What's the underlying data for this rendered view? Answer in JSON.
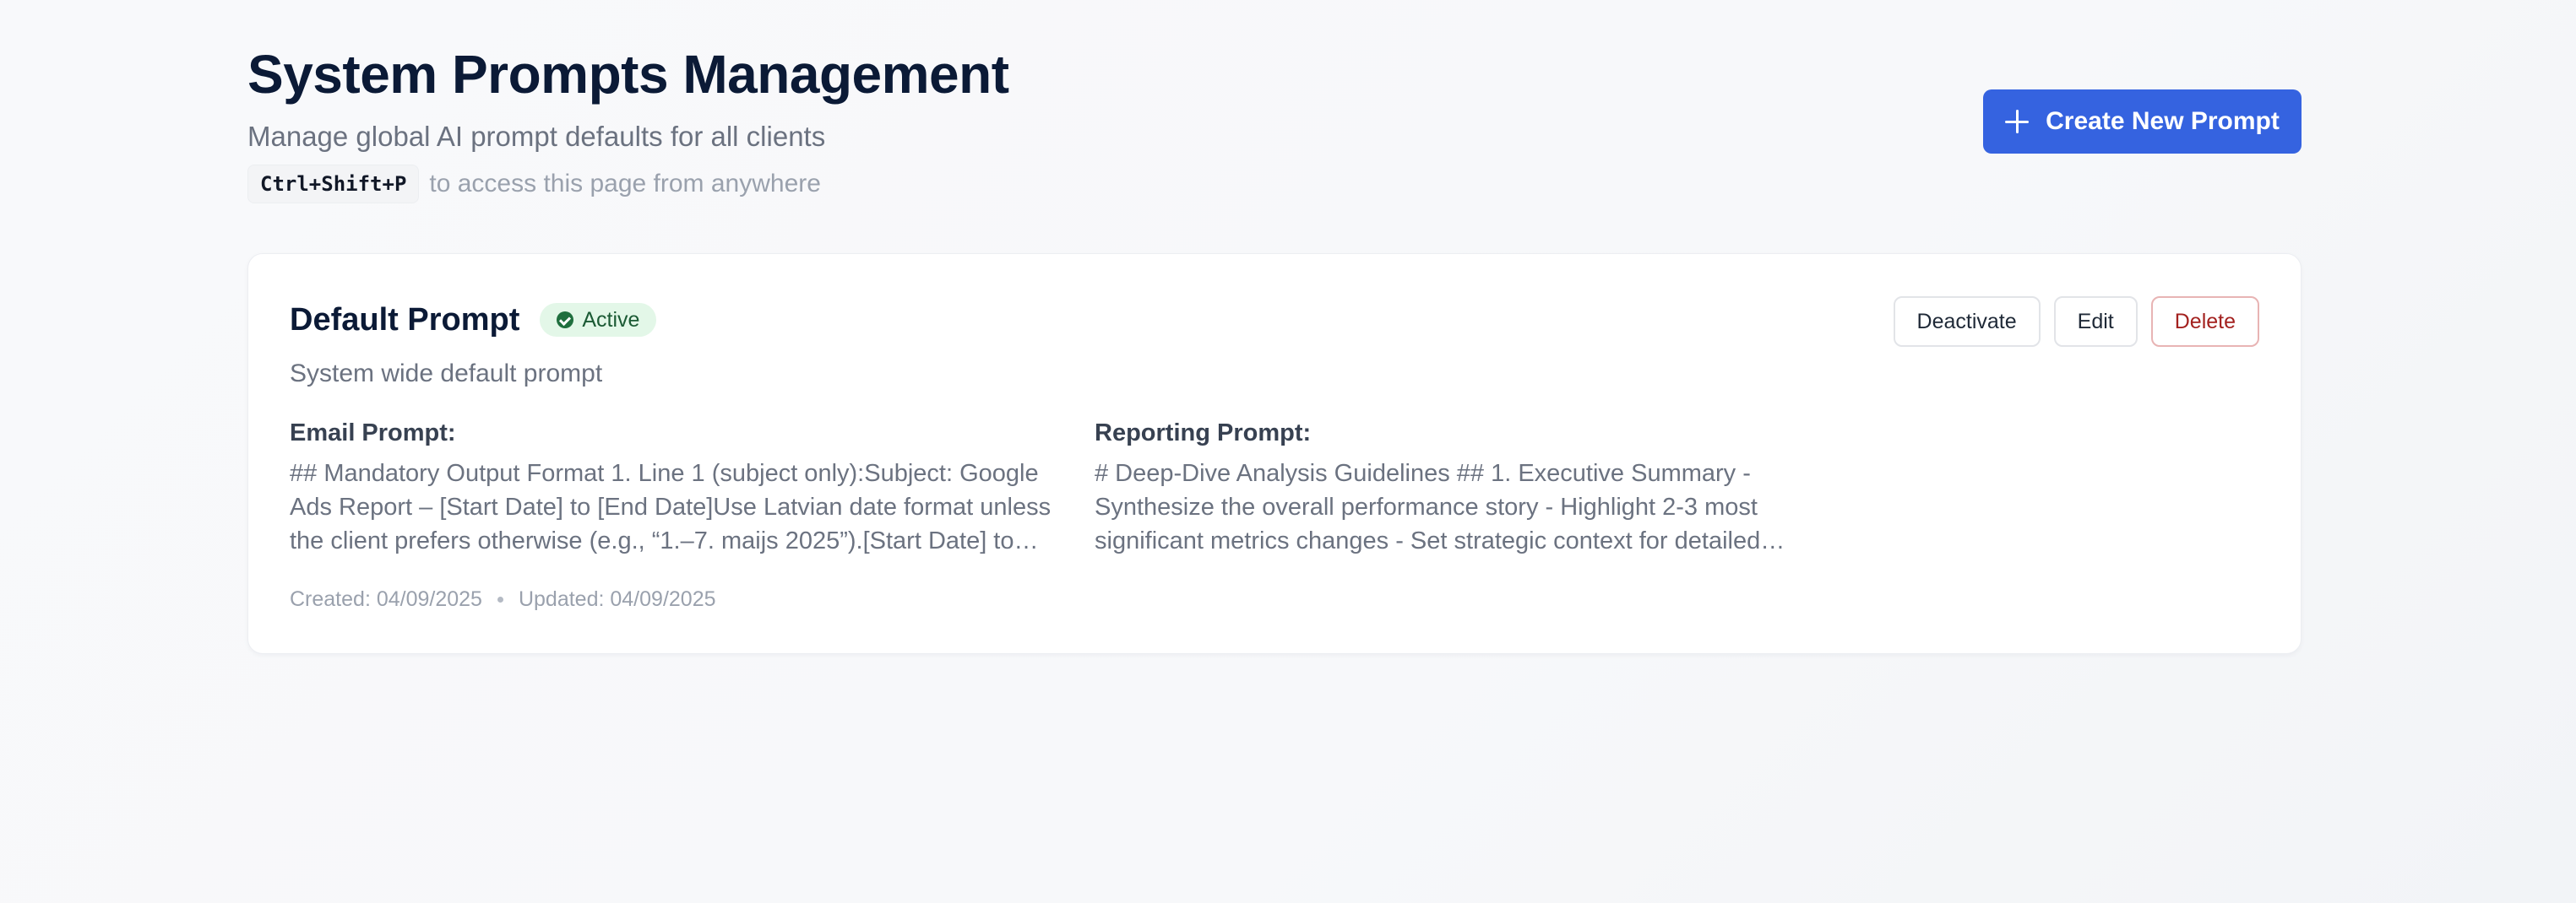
{
  "header": {
    "title": "System Prompts Management",
    "subtitle": "Manage global AI prompt defaults for all clients",
    "shortcut_key": "Ctrl+Shift+P",
    "shortcut_hint": "to access this page from anywhere",
    "create_button_label": "Create New Prompt"
  },
  "prompt_card": {
    "title": "Default Prompt",
    "status": "Active",
    "description": "System wide default prompt",
    "actions": {
      "deactivate_label": "Deactivate",
      "edit_label": "Edit",
      "delete_label": "Delete"
    },
    "email_prompt": {
      "label": "Email Prompt:",
      "text": "## Mandatory Output Format 1. Line 1 (subject only):Subject: Google Ads Report – [Start Date] to [End Date]Use Latvian date format unless the client prefers otherwise (e.g., “1.–7. maijs 2025”).[Start Date] to [End Date]"
    },
    "reporting_prompt": {
      "label": "Reporting Prompt:",
      "text": "# Deep-Dive Analysis Guidelines ## 1. Executive Summary - Synthesize the overall performance story - Highlight 2-3 most significant metrics changes - Set strategic context for detailed analysis"
    },
    "created": "Created: 04/09/2025",
    "updated": "Updated: 04/09/2025"
  },
  "colors": {
    "primary": "#3563e0",
    "danger": "#a3211f",
    "success_bg": "#e3f7e8",
    "success_fg": "#1b5a34"
  },
  "icons": {
    "create_button": "plus-icon",
    "status_badge": "check-circle-icon"
  }
}
